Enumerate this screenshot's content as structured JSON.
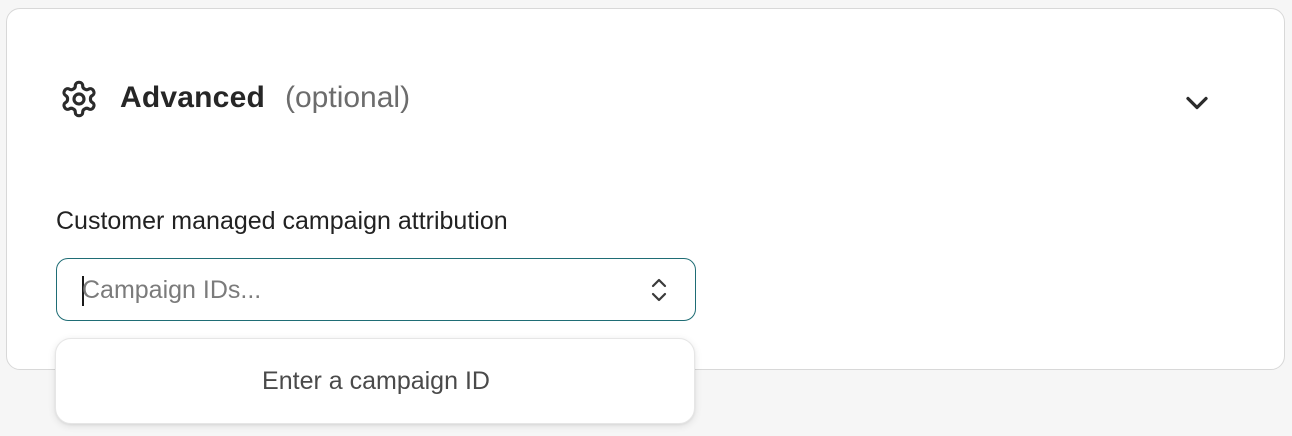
{
  "section": {
    "icon": "gear-icon",
    "title": "Advanced",
    "subtitle": "(optional)",
    "toggle_icon": "chevron-down-icon"
  },
  "field": {
    "label": "Customer managed campaign attribution",
    "value": "",
    "placeholder": "Campaign IDs...",
    "icon": "chevron-up-down-icon",
    "accent_color": "#1f6d75"
  },
  "dropdown": {
    "empty_message": "Enter a campaign ID"
  }
}
